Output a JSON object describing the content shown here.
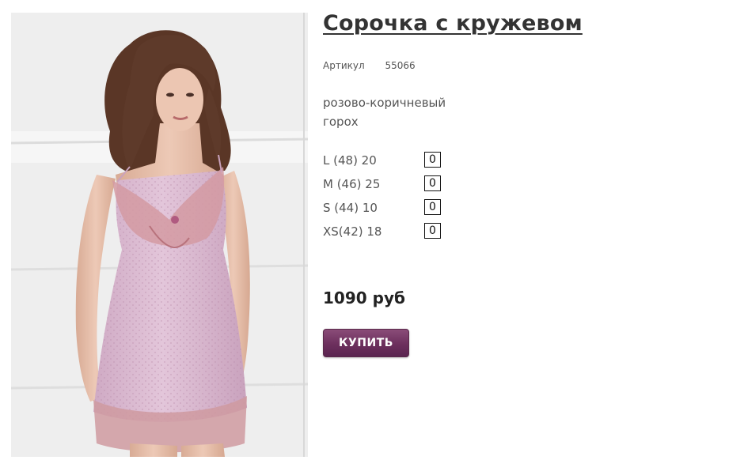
{
  "product": {
    "title": "Сорочка с кружевом",
    "sku_label": "Артикул",
    "sku_value": "55066",
    "color": "розово-коричневый горох",
    "image_alt": "photo-product-nightgown",
    "sizes": [
      {
        "label": "L (48)  20",
        "qty": "0"
      },
      {
        "label": "M (46)  25",
        "qty": "0"
      },
      {
        "label": "S (44)  10",
        "qty": "0"
      },
      {
        "label": "XS(42)  18",
        "qty": "0"
      }
    ],
    "price": "1090 руб",
    "buy_label": "КУПИТЬ"
  },
  "colors": {
    "button": "#6c2f5d",
    "text": "#333333",
    "garment": "#d9b7cf",
    "lace": "#c78b92"
  }
}
